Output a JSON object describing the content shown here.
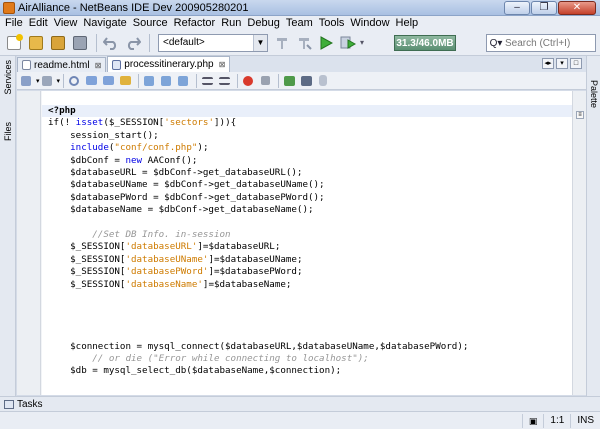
{
  "window": {
    "title": "AirAlliance - NetBeans IDE Dev 200905280201",
    "minimize": "‒",
    "maximize": "❐",
    "close": "✕"
  },
  "menu": [
    "File",
    "Edit",
    "View",
    "Navigate",
    "Source",
    "Refactor",
    "Run",
    "Debug",
    "Team",
    "Tools",
    "Window",
    "Help"
  ],
  "toolbar": {
    "config_value": "<default>",
    "memory": "31.3/46.0MB",
    "search_placeholder": "Search (Ctrl+I)"
  },
  "side_panels": {
    "services": "Services",
    "files": "Files",
    "palette": "Palette"
  },
  "tabs": [
    {
      "label": "readme.html",
      "active": false
    },
    {
      "label": "processitinerary.php",
      "active": true
    }
  ],
  "code_lines": [
    [
      {
        "t": "<?php",
        "c": "tag"
      }
    ],
    [
      {
        "t": "if(! ",
        "c": "var"
      },
      {
        "t": "isset",
        "c": "kw"
      },
      {
        "t": "($_SESSION[",
        "c": "var"
      },
      {
        "t": "'sectors'",
        "c": "str"
      },
      {
        "t": "])){",
        "c": "var"
      }
    ],
    [
      {
        "t": "    session_start();",
        "c": "var"
      }
    ],
    [
      {
        "t": "    ",
        "c": "var"
      },
      {
        "t": "include",
        "c": "kw"
      },
      {
        "t": "(",
        "c": "var"
      },
      {
        "t": "\"conf/conf.php\"",
        "c": "str"
      },
      {
        "t": ");",
        "c": "var"
      }
    ],
    [
      {
        "t": "    $dbConf = ",
        "c": "var"
      },
      {
        "t": "new",
        "c": "kw"
      },
      {
        "t": " AAConf();",
        "c": "var"
      }
    ],
    [
      {
        "t": "    $databaseURL = $dbConf->get_databaseURL();",
        "c": "var"
      }
    ],
    [
      {
        "t": "    $databaseUName = $dbConf->get_databaseUName();",
        "c": "var"
      }
    ],
    [
      {
        "t": "    $databasePWord = $dbConf->get_databasePWord();",
        "c": "var"
      }
    ],
    [
      {
        "t": "    $databaseName = $dbConf->get_databaseName();",
        "c": "var"
      }
    ],
    [
      {
        "t": "",
        "c": "var"
      }
    ],
    [
      {
        "t": "        //Set DB Info. in-session",
        "c": "com"
      }
    ],
    [
      {
        "t": "    $_SESSION[",
        "c": "var"
      },
      {
        "t": "'databaseURL'",
        "c": "str"
      },
      {
        "t": "]=$databaseURL;",
        "c": "var"
      }
    ],
    [
      {
        "t": "    $_SESSION[",
        "c": "var"
      },
      {
        "t": "'databaseUName'",
        "c": "str"
      },
      {
        "t": "]=$databaseUName;",
        "c": "var"
      }
    ],
    [
      {
        "t": "    $_SESSION[",
        "c": "var"
      },
      {
        "t": "'databasePWord'",
        "c": "str"
      },
      {
        "t": "]=$databasePWord;",
        "c": "var"
      }
    ],
    [
      {
        "t": "    $_SESSION[",
        "c": "var"
      },
      {
        "t": "'databaseName'",
        "c": "str"
      },
      {
        "t": "]=$databaseName;",
        "c": "var"
      }
    ],
    [
      {
        "t": "",
        "c": "var"
      }
    ],
    [
      {
        "t": "",
        "c": "var"
      }
    ],
    [
      {
        "t": "",
        "c": "var"
      }
    ],
    [
      {
        "t": "",
        "c": "var"
      }
    ],
    [
      {
        "t": "    $connection = mysql_connect($databaseURL,$databaseUName,$databasePWord);",
        "c": "var"
      }
    ],
    [
      {
        "t": "        // or die (\"Error while connecting to localhost\");",
        "c": "com"
      }
    ],
    [
      {
        "t": "    $db = mysql_select_db($databaseName,$connection);",
        "c": "var"
      }
    ]
  ],
  "bottom": {
    "tasks_label": "Tasks",
    "cursor_pos": "1:1",
    "insert_mode": "INS"
  },
  "colors": {
    "keyword": "#0000e6",
    "string": "#ce7b00",
    "comment": "#969696",
    "current_line": "#e9effa"
  }
}
